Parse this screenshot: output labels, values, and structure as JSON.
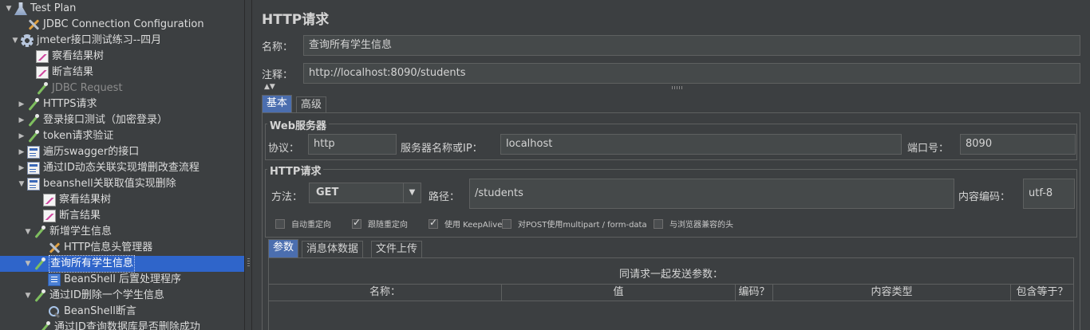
{
  "tree": {
    "items": [
      {
        "label": "Test Plan",
        "toggle": "▼",
        "icon": "flask-icon"
      },
      {
        "label": "JDBC Connection Configuration",
        "toggle": "",
        "icon": "tools-icon"
      },
      {
        "label": "jmeter接口测试练习--四月",
        "toggle": "▼",
        "icon": "gear-icon"
      },
      {
        "label": "察看结果树",
        "toggle": "",
        "icon": "chart-icon"
      },
      {
        "label": "断言结果",
        "toggle": "",
        "icon": "chart-icon"
      },
      {
        "label": "JDBC Request",
        "toggle": "",
        "icon": "pipette-icon"
      },
      {
        "label": "HTTPS请求",
        "toggle": "▶",
        "icon": "pipette-icon"
      },
      {
        "label": "登录接口测试（加密登录）",
        "toggle": "▶",
        "icon": "pipette-icon"
      },
      {
        "label": "token请求验证",
        "toggle": "▶",
        "icon": "pipette-icon"
      },
      {
        "label": "遍历swagger的接口",
        "toggle": "▶",
        "icon": "doc-icon"
      },
      {
        "label": "通过ID动态关联实现增删改查流程",
        "toggle": "▶",
        "icon": "doc-icon"
      },
      {
        "label": "beanshell关联取值实现删除",
        "toggle": "▼",
        "icon": "doc-icon"
      },
      {
        "label": "察看结果树",
        "toggle": "",
        "icon": "chart-icon"
      },
      {
        "label": "断言结果",
        "toggle": "",
        "icon": "chart-icon"
      },
      {
        "label": "新增学生信息",
        "toggle": "▼",
        "icon": "pipette-icon"
      },
      {
        "label": "HTTP信息头管理器",
        "toggle": "",
        "icon": "tools-icon"
      },
      {
        "label": "查询所有学生信息",
        "toggle": "▼",
        "icon": "pipette-icon"
      },
      {
        "label": "BeanShell 后置处理程序",
        "toggle": "",
        "icon": "page-icon"
      },
      {
        "label": "通过ID删除一个学生信息",
        "toggle": "▼",
        "icon": "pipette-icon"
      },
      {
        "label": "BeanShell断言",
        "toggle": "",
        "icon": "magnifier-icon"
      },
      {
        "label": "通过ID查询数据库是否删除成功",
        "toggle": "",
        "icon": "pipette-icon"
      }
    ]
  },
  "panel": {
    "title": "HTTP请求",
    "name_label": "名称：",
    "name_value": "查询所有学生信息",
    "comment_label": "注释：",
    "comment_value": "http://localhost:8090/students",
    "tabs": [
      "基本",
      "高级"
    ],
    "web_server": {
      "title": "Web服务器",
      "protocol_label": "协议：",
      "protocol_value": "http",
      "server_label": "服务器名称或IP：",
      "server_value": "localhost",
      "port_label": "端口号：",
      "port_value": "8090"
    },
    "http_request": {
      "title": "HTTP请求",
      "method_label": "方法：",
      "method_value": "GET",
      "path_label": "路径：",
      "path_value": "/students",
      "encoding_label": "内容编码：",
      "encoding_value": "utf-8"
    },
    "options": [
      {
        "label": "自动重定向",
        "checked": false
      },
      {
        "label": "跟随重定向",
        "checked": true
      },
      {
        "label": "使用 KeepAlive",
        "checked": true
      },
      {
        "label": "对POST使用multipart / form-data",
        "checked": false
      },
      {
        "label": "与浏览器兼容的头",
        "checked": false
      }
    ],
    "sub_tabs": [
      "参数",
      "消息体数据",
      "文件上传"
    ],
    "params_caption": "同请求一起发送参数：",
    "columns": [
      "名称：",
      "值",
      "编码？",
      "内容类型",
      "包含等于？"
    ]
  }
}
